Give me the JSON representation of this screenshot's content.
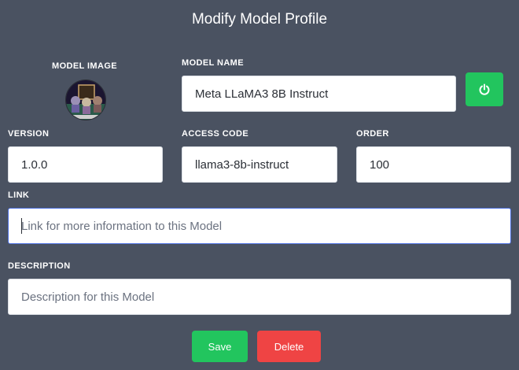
{
  "dialog": {
    "title": "Modify Model Profile"
  },
  "model_image": {
    "label": "MODEL IMAGE"
  },
  "fields": {
    "model_name": {
      "label": "MODEL NAME",
      "value": "Meta LLaMA3 8B Instruct"
    },
    "version": {
      "label": "VERSION",
      "value": "1.0.0"
    },
    "access_code": {
      "label": "ACCESS CODE",
      "value": "llama3-8b-instruct"
    },
    "order": {
      "label": "ORDER",
      "value": "100"
    },
    "link": {
      "label": "LINK",
      "value": "",
      "placeholder": "Link for more information to this Model"
    },
    "description": {
      "label": "DESCRIPTION",
      "value": "",
      "placeholder": "Description for this Model"
    }
  },
  "actions": {
    "power_icon": "power-icon",
    "save_label": "Save",
    "delete_label": "Delete"
  },
  "colors": {
    "background": "#4a5261",
    "primary_green": "#22c55e",
    "danger_red": "#ef4444",
    "focus_border": "#4a6ee0"
  }
}
